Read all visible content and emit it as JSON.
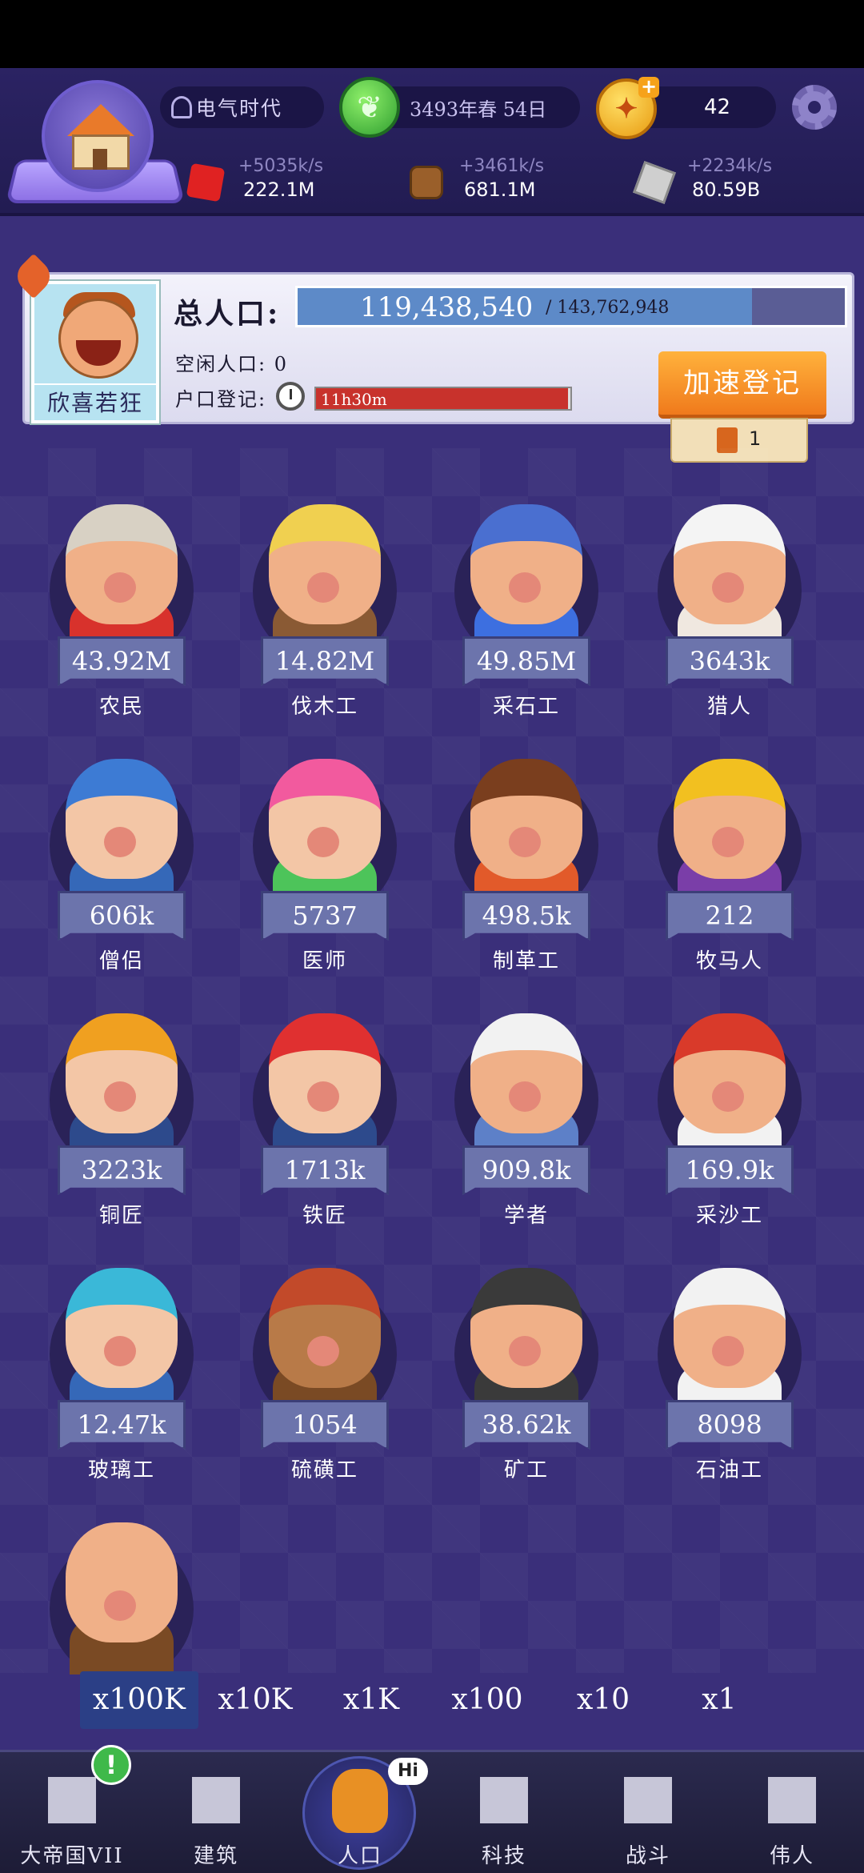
{
  "topbar": {
    "era": "电气时代",
    "date": "3493年春 54日",
    "coins": "42"
  },
  "resources": [
    {
      "name": "food",
      "rate": "+5035k/s",
      "amount": "222.1M",
      "icon": "meat-icon"
    },
    {
      "name": "wood",
      "rate": "+3461k/s",
      "amount": "681.1M",
      "icon": "wood-icon"
    },
    {
      "name": "stone",
      "rate": "+2234k/s",
      "amount": "80.59B",
      "icon": "stone-icon"
    }
  ],
  "population": {
    "mood": "欣喜若狂",
    "title": "总人口:",
    "current": "119,438,540",
    "max": "/ 143,762,948",
    "fill_fraction": 0.83,
    "idle_label": "空闲人口: 0",
    "register_label": "户口登记:",
    "register_timer": "11h30m",
    "register_fill_fraction": 0.99,
    "speedup_label": "加速登记",
    "tickets": "1"
  },
  "jobs": [
    {
      "label": "农民",
      "count": "43.92M",
      "hair": "#d8d1c4",
      "skin": "#f0b088",
      "shirt": "#d8322c"
    },
    {
      "label": "伐木工",
      "count": "14.82M",
      "hair": "#f0d050",
      "skin": "#f0b088",
      "shirt": "#8a5a34"
    },
    {
      "label": "采石工",
      "count": "49.85M",
      "hair": "#4a6fd0",
      "skin": "#f0b088",
      "shirt": "#3d6fe0"
    },
    {
      "label": "猎人",
      "count": "3643k",
      "hair": "#f4f4f4",
      "skin": "#f0b088",
      "shirt": "#f0e8e0"
    },
    {
      "label": "僧侣",
      "count": "606k",
      "hair": "#3d7bd4",
      "skin": "#f3c6a6",
      "shirt": "#3568b8"
    },
    {
      "label": "医师",
      "count": "5737",
      "hair": "#f25a9e",
      "skin": "#f3c6a6",
      "shirt": "#4dc45a"
    },
    {
      "label": "制革工",
      "count": "498.5k",
      "hair": "#7a3e1e",
      "skin": "#f0b088",
      "shirt": "#e25a2a"
    },
    {
      "label": "牧马人",
      "count": "212",
      "hair": "#f2c020",
      "skin": "#f0b088",
      "shirt": "#7a3ea8"
    },
    {
      "label": "铜匠",
      "count": "3223k",
      "hair": "#f0a020",
      "skin": "#f3c6a6",
      "shirt": "#2d4a8c"
    },
    {
      "label": "铁匠",
      "count": "1713k",
      "hair": "#e03030",
      "skin": "#f3c6a6",
      "shirt": "#2d4a8c"
    },
    {
      "label": "学者",
      "count": "909.8k",
      "hair": "#f2f2f2",
      "skin": "#f0b088",
      "shirt": "#5d80c8"
    },
    {
      "label": "采沙工",
      "count": "169.9k",
      "hair": "#d93a2a",
      "skin": "#f0b088",
      "shirt": "#f2f2f2"
    },
    {
      "label": "玻璃工",
      "count": "12.47k",
      "hair": "#3ab8d8",
      "skin": "#f3c6a6",
      "shirt": "#3568b8"
    },
    {
      "label": "硫磺工",
      "count": "1054",
      "hair": "#c24a2a",
      "skin": "#b87a48",
      "shirt": "#7a4a24"
    },
    {
      "label": "矿工",
      "count": "38.62k",
      "hair": "#3a3a3a",
      "skin": "#f0b088",
      "shirt": "#3a3a3a"
    },
    {
      "label": "石油工",
      "count": "8098",
      "hair": "#f2f2f2",
      "skin": "#f0b088",
      "shirt": "#f2f2f2"
    },
    {
      "label": "",
      "count": "",
      "hair": "#f0b088",
      "skin": "#f0b088",
      "shirt": "#7a4a24"
    }
  ],
  "multipliers": [
    "x100K",
    "x10K",
    "x1K",
    "x100",
    "x10",
    "x1"
  ],
  "active_multiplier": "x100K",
  "nav": [
    {
      "label": "大帝国VII",
      "icon": "castle-icon"
    },
    {
      "label": "建筑",
      "icon": "house-icon"
    },
    {
      "label": "人口",
      "icon": "person-icon"
    },
    {
      "label": "科技",
      "icon": "book-icon"
    },
    {
      "label": "战斗",
      "icon": "swords-icon"
    },
    {
      "label": "伟人",
      "icon": "statue-icon"
    }
  ],
  "nav_hi": "Hi",
  "nav_alert": "!"
}
